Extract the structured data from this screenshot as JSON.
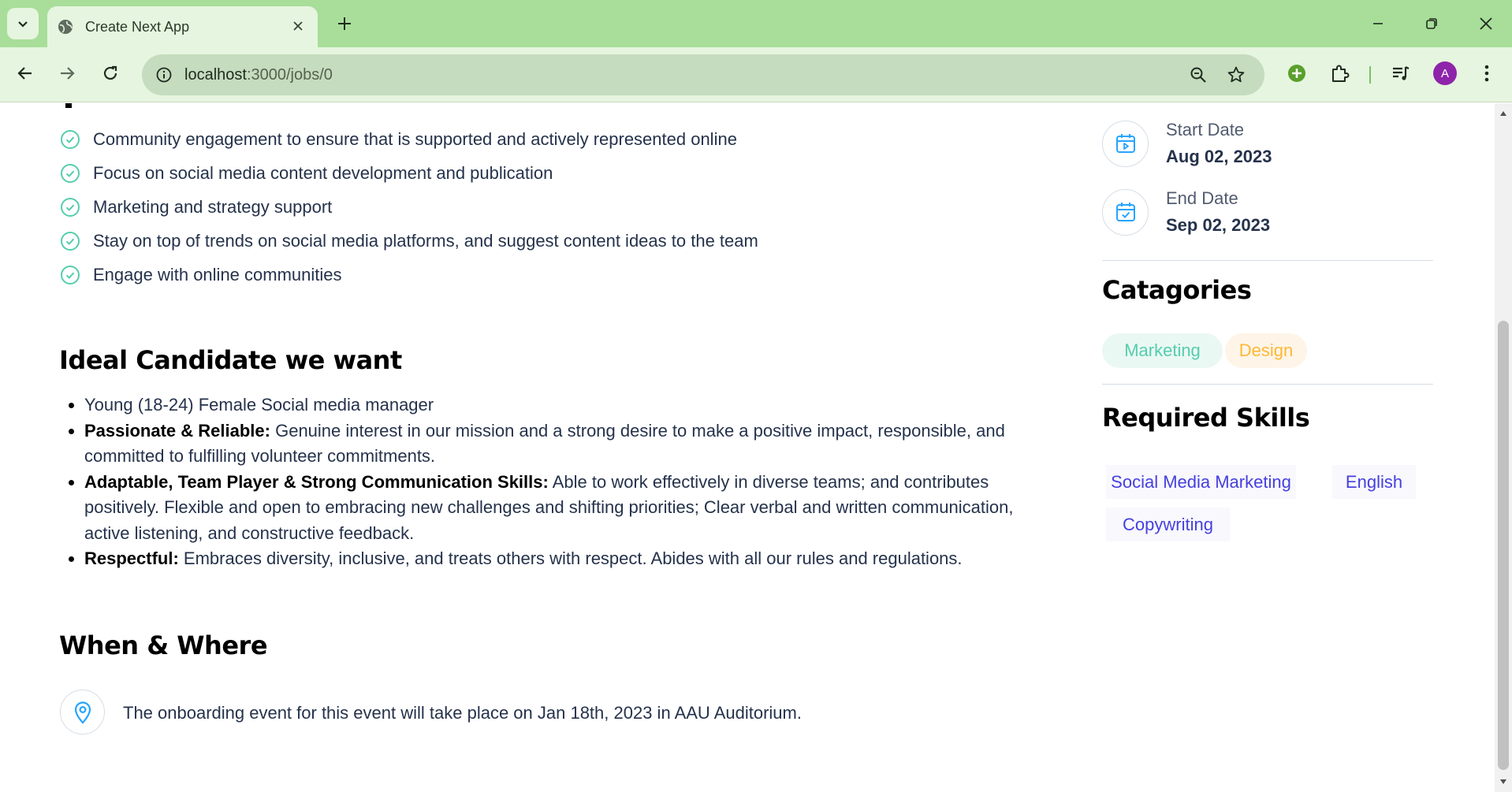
{
  "browser": {
    "tab_title": "Create Next App",
    "url_host": "localhost",
    "url_path": ":3000/jobs/0",
    "profile_initial": "A"
  },
  "page": {
    "responsibilities": [
      "Community engagement to ensure that is supported and actively represented online",
      "Focus on social media content development and publication",
      "Marketing and strategy support",
      "Stay on top of trends on social media platforms, and suggest content ideas to the team",
      "Engage with online communities"
    ],
    "ideal_candidate": {
      "heading": "Ideal Candidate we want",
      "items": [
        {
          "bold": "",
          "text": "Young (18-24) Female Social media manager"
        },
        {
          "bold": "Passionate & Reliable:",
          "text": " Genuine interest in our mission and a strong desire to make a positive impact, responsible, and committed to fulfilling volunteer commitments."
        },
        {
          "bold": "Adaptable, Team Player & Strong Communication Skills:",
          "text": " Able to work effectively in diverse teams; and contributes positively. Flexible and open to embracing new challenges and shifting priorities; Clear verbal and written communication, active listening, and constructive feedback."
        },
        {
          "bold": "Respectful:",
          "text": " Embraces diversity, inclusive, and treats others with respect. Abides with all our rules and regulations."
        }
      ]
    },
    "when_where": {
      "heading": "When & Where",
      "text": "The onboarding event for this event will take place on Jan 18th, 2023 in AAU Auditorium."
    }
  },
  "sidebar": {
    "start_date": {
      "label": "Start Date",
      "value": "Aug 02, 2023"
    },
    "end_date": {
      "label": "End Date",
      "value": "Sep 02, 2023"
    },
    "categories_heading": "Catagories",
    "categories": [
      "Marketing",
      "Design"
    ],
    "skills_heading": "Required Skills",
    "skills": [
      "Social Media Marketing",
      "English",
      "Copywriting"
    ]
  },
  "colors": {
    "marketing_bg": "#eaf8f3",
    "marketing_fg": "#56cdad",
    "design_bg": "#fef5e8",
    "design_fg": "#ffb836",
    "skill_fg": "#4640de",
    "check": "#56cdad",
    "icon_blue": "#26a4ff"
  }
}
